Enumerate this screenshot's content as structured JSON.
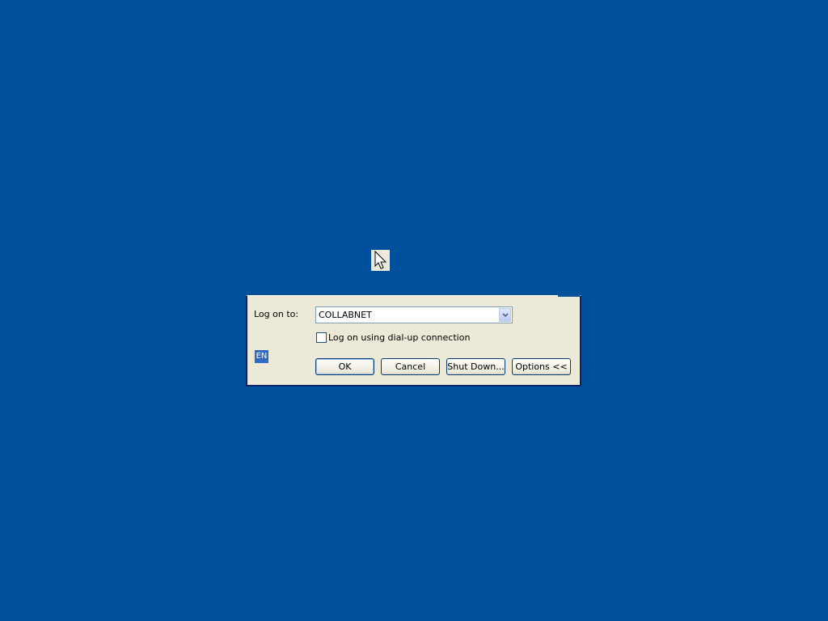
{
  "dialog": {
    "logon_label": "Log on to:",
    "domain_value": "COLLABNET",
    "dialup_checkbox_label": "Log on using dial-up connection",
    "dialup_checked": false,
    "language_indicator": "EN",
    "buttons": {
      "ok": "OK",
      "cancel": "Cancel",
      "shutdown": "Shut Down...",
      "options": "Options <<"
    }
  },
  "icons": [
    "mouse-pointer-icon",
    "chevron-down-icon"
  ],
  "colors": {
    "desktop_background": "#00519c",
    "dialog_background": "#ece9d8",
    "dialog_border": "#0a246a",
    "language_indicator_background": "#316ac5"
  }
}
